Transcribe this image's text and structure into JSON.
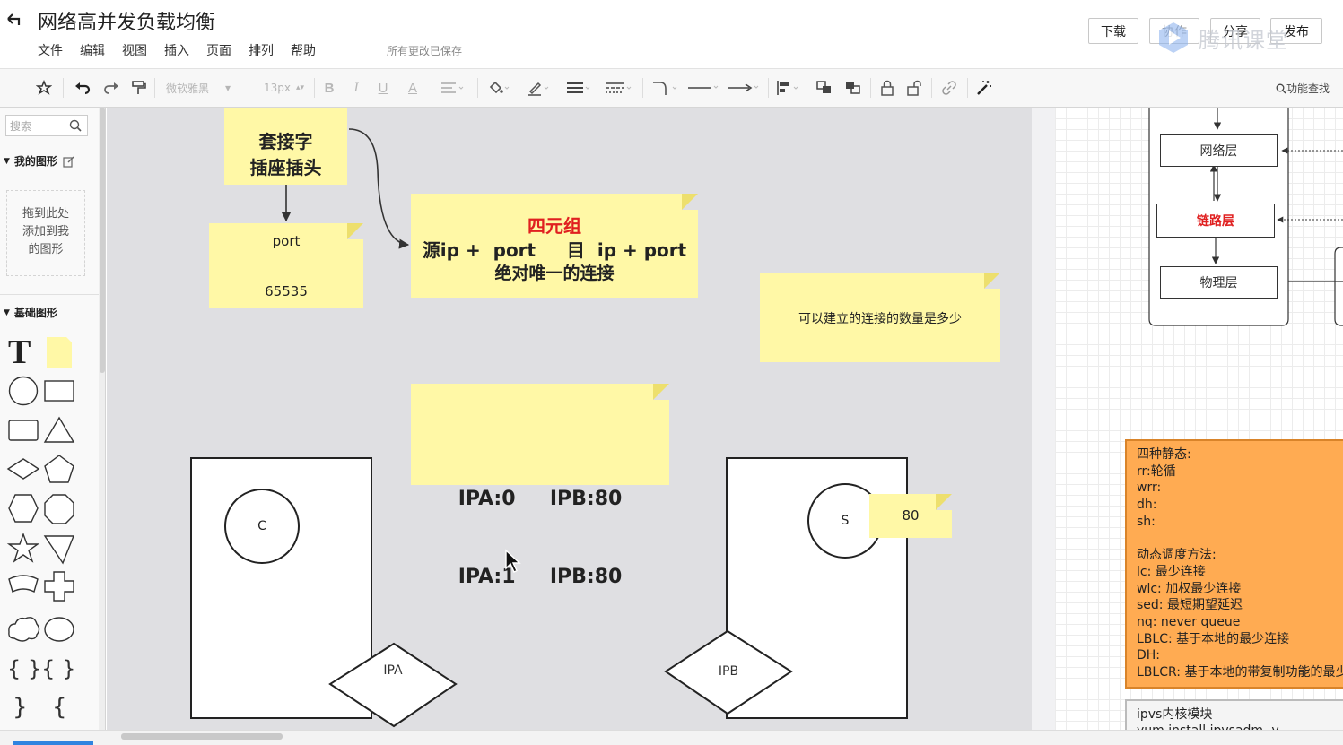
{
  "header": {
    "title": "网络高并发负载均衡",
    "menu": [
      "文件",
      "编辑",
      "视图",
      "插入",
      "页面",
      "排列",
      "帮助"
    ],
    "save_status": "所有更改已保存",
    "buttons": {
      "download": "下载",
      "collab": "协作",
      "share": "分享",
      "publish": "发布"
    },
    "watermark": "腾讯课堂"
  },
  "toolbar": {
    "font_family": "微软雅黑",
    "font_size": "13px",
    "bold": "B",
    "italic": "I",
    "underline": "U",
    "font_color": "A",
    "func_search": "功能查找"
  },
  "sidebar": {
    "search_placeholder": "搜索",
    "my_shapes": "我的图形",
    "drop_hint": [
      "拖到此处",
      "添加到我",
      "的图形"
    ],
    "basic_shapes": "基础图形",
    "text_tool": "T"
  },
  "canvas": {
    "note_socket": [
      "套接字",
      "插座插头"
    ],
    "note_port": {
      "label": "port",
      "value": "65535"
    },
    "note_four_tuple": {
      "title": "四元组",
      "line1": "源ip +  port     目  ip + port",
      "line2": "绝对唯一的连接"
    },
    "note_question": "可以建立的连接的数量是多少",
    "note_ipa": [
      "IPA:0     IPB:80",
      "IPA:1     IPB:80"
    ],
    "client_circle": "C",
    "server_circle": "S",
    "note_80": "80",
    "diamond_ipa": "IPA",
    "diamond_ipb": "IPB",
    "layers": {
      "network": "网络层",
      "link": "链路层",
      "physical": "物理层"
    },
    "orange_note": [
      "四种静态:",
      "rr:轮循",
      "wrr:",
      "dh:",
      "sh:",
      "",
      "动态调度方法:",
      "lc: 最少连接",
      "wlc: 加权最少连接",
      "sed: 最短期望延迟",
      "nq: never queue",
      "LBLC: 基于本地的最少连接",
      "DH:",
      "LBLCR: 基于本地的带复制功能的最少连接"
    ],
    "gray_note": [
      "ipvs内核模块",
      "yum install ipvsadm -y"
    ]
  },
  "colors": {
    "sticky": "#fff8a6",
    "canvas_bg": "#dfdfe2",
    "accent_red": "#e02020",
    "orange_note": "#ffab52"
  },
  "icons": [
    "back-arrow-icon",
    "pointer-icon",
    "undo-icon",
    "redo-icon",
    "format-painter-icon",
    "fill-icon",
    "line-color-icon",
    "line-width-icon",
    "line-style-icon",
    "connector-icon",
    "arrow-icon",
    "align-icon",
    "front-icon",
    "back-icon",
    "lock-icon",
    "unlock-icon",
    "link-icon",
    "magic-icon",
    "search-icon"
  ]
}
